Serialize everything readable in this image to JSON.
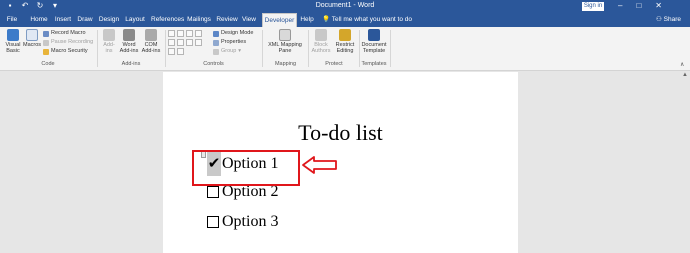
{
  "app": {
    "document_title": "Document1 - Word",
    "sign_in_label": "Sign in",
    "qat_icons": [
      "save-icon",
      "undo-icon",
      "redo-icon",
      "customize-icon"
    ],
    "window_buttons": [
      "–",
      "□",
      "✕"
    ]
  },
  "tabs": [
    {
      "label": "File",
      "active": false
    },
    {
      "label": "Home",
      "active": false
    },
    {
      "label": "Insert",
      "active": false
    },
    {
      "label": "Draw",
      "active": false
    },
    {
      "label": "Design",
      "active": false
    },
    {
      "label": "Layout",
      "active": false
    },
    {
      "label": "References",
      "active": false
    },
    {
      "label": "Mailings",
      "active": false
    },
    {
      "label": "Review",
      "active": false
    },
    {
      "label": "View",
      "active": false
    },
    {
      "label": "Developer",
      "active": true
    },
    {
      "label": "Help",
      "active": false
    }
  ],
  "tell_me": "Tell me what you want to do",
  "share_label": "Share",
  "ribbon": {
    "code": {
      "visual_basic": "Visual Basic",
      "macros": "Macros",
      "record_macro": "Record Macro",
      "pause_recording": "Pause Recording",
      "macro_security": "Macro Security",
      "group_label": "Code"
    },
    "addins": {
      "addins": "Add-ins",
      "word_addins": "Word Add-ins",
      "com_addins": "COM Add-ins",
      "group_label": "Add-ins"
    },
    "controls": {
      "design_mode": "Design Mode",
      "properties": "Properties",
      "group": "Group",
      "group_label": "Controls"
    },
    "mapping": {
      "xml_mapping_pane": "XML Mapping Pane",
      "group_label": "Mapping"
    },
    "protect": {
      "block_authors": "Block Authors",
      "restrict_editing": "Restrict Editing",
      "group_label": "Protect"
    },
    "templates": {
      "document_template": "Document Template",
      "group_label": "Templates"
    }
  },
  "document": {
    "heading": "To-do list",
    "items": [
      {
        "label": "Option 1",
        "checked": true,
        "mark": "✔"
      },
      {
        "label": "Option 2",
        "checked": false
      },
      {
        "label": "Option 3",
        "checked": false
      }
    ]
  },
  "colors": {
    "word_blue": "#2b579a",
    "highlight_red": "#e0161b",
    "ribbon_bg": "#f3f3f3"
  }
}
